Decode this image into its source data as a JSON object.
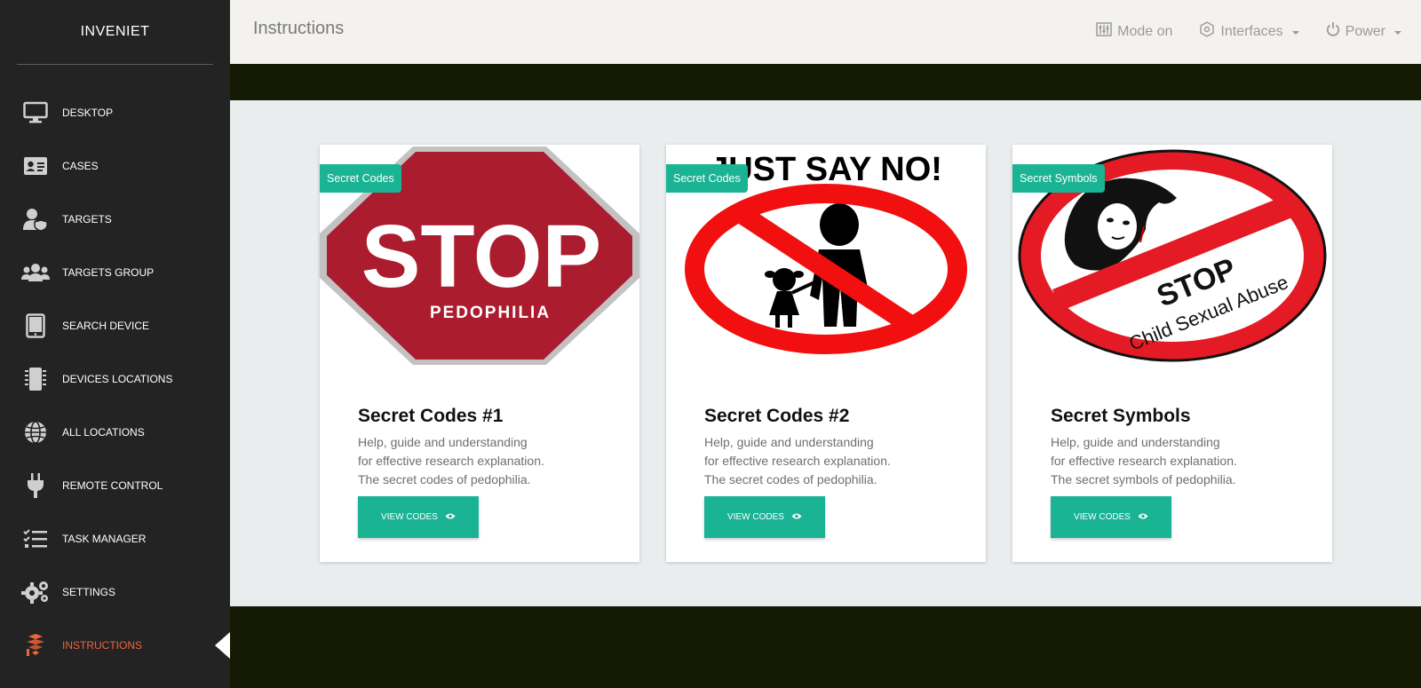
{
  "brand": "INVENIET",
  "sidebar": {
    "items": [
      {
        "label": "DESKTOP",
        "icon": "desktop-icon"
      },
      {
        "label": "CASES",
        "icon": "id-card-icon"
      },
      {
        "label": "TARGETS",
        "icon": "user-shield-icon"
      },
      {
        "label": "TARGETS GROUP",
        "icon": "users-icon"
      },
      {
        "label": "SEARCH DEVICE",
        "icon": "tablet-icon"
      },
      {
        "label": "DEVICES LOCATIONS",
        "icon": "chip-icon"
      },
      {
        "label": "ALL LOCATIONS",
        "icon": "globe-icon"
      },
      {
        "label": "REMOTE CONTROL",
        "icon": "plug-icon"
      },
      {
        "label": "TASK MANAGER",
        "icon": "tasks-icon"
      },
      {
        "label": "SETTINGS",
        "icon": "gears-icon"
      },
      {
        "label": "INSTRUCTIONS",
        "icon": "layers-icon",
        "active": true
      }
    ]
  },
  "header": {
    "title": "Instructions",
    "mode": "Mode on",
    "interfaces": "Interfaces",
    "power": "Power"
  },
  "cards": [
    {
      "badge": "Secret Codes",
      "title": "Secret Codes #1",
      "lines": [
        "Help, guide and understanding",
        "for effective research explanation.",
        "The secret codes of pedophilia."
      ],
      "button": "VIEW CODES",
      "image_text": [
        "STOP",
        "PEDOPHILIA"
      ]
    },
    {
      "badge": "Secret Codes",
      "title": "Secret Codes #2",
      "lines": [
        "Help, guide and understanding",
        "for effective research explanation.",
        "The secret codes of pedophilia."
      ],
      "button": "VIEW CODES",
      "image_text": [
        "JUST SAY NO!"
      ]
    },
    {
      "badge": "Secret Symbols",
      "title": "Secret Symbols",
      "lines": [
        "Help, guide and understanding",
        "for effective research explanation.",
        "The secret symbols of pedophilia."
      ],
      "button": "VIEW CODES",
      "image_text": [
        "STOP",
        "Child Sexual Abuse"
      ]
    }
  ],
  "colors": {
    "sidebar_bg": "#232323",
    "accent": "#1ab394",
    "active": "#f0643a",
    "dark_band": "#141a04"
  }
}
